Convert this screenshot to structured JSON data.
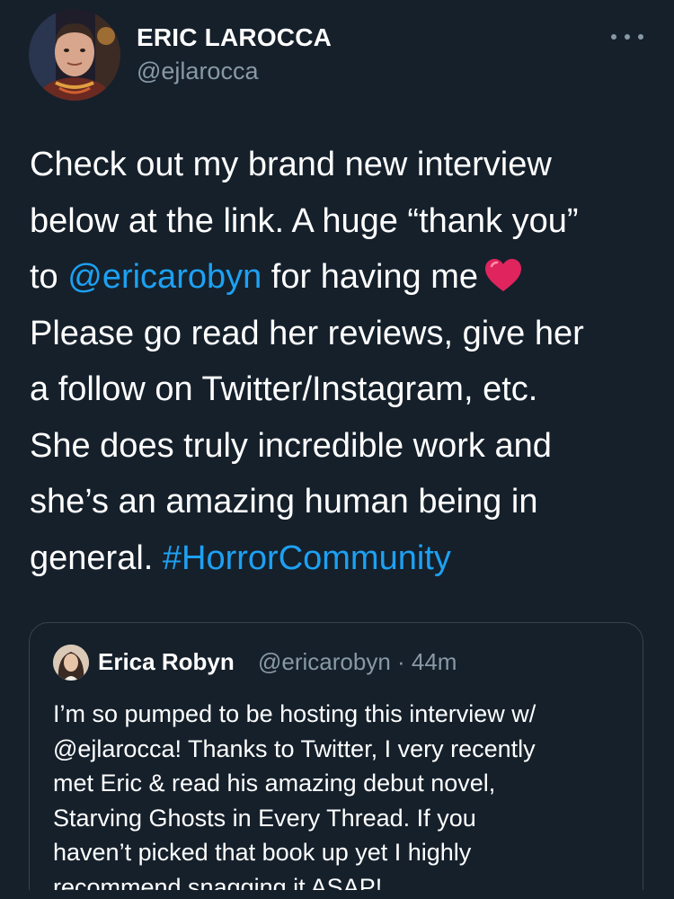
{
  "author": {
    "name": "ERIC LAROCCA",
    "handle": "@ejlarocca"
  },
  "tweet": {
    "lines": [
      [
        "Check out my brand new interview"
      ],
      [
        "below at the link. A huge “thank you”"
      ],
      [
        "to ",
        "@ericarobyn",
        " for having me"
      ],
      [
        "Please go read her reviews, give her"
      ],
      [
        "a follow on Twitter/Instagram, etc."
      ],
      [
        "She does truly incredible work and"
      ],
      [
        "she’s an amazing human being in"
      ],
      [
        "general. ",
        "#HorrorCommunity"
      ]
    ],
    "heart_icon": "red-heart-emoji"
  },
  "quoted_tweet": {
    "name": "Erica Robyn",
    "handle": "@ericarobyn · 44m",
    "lines": [
      "I’m so pumped to be hosting this interview w/",
      "@ejlarocca! Thanks to Twitter, I very recently",
      "met Eric & read his amazing debut novel,",
      "Starving Ghosts in Every Thread. If you",
      "haven’t picked that book up yet I highly",
      "recommend snagging it ASAP!"
    ]
  },
  "colors": {
    "background": "#15202b",
    "link": "#1da1f2",
    "secondary_text": "#8899a6",
    "border": "#38444d",
    "heart": "#e0245e"
  }
}
